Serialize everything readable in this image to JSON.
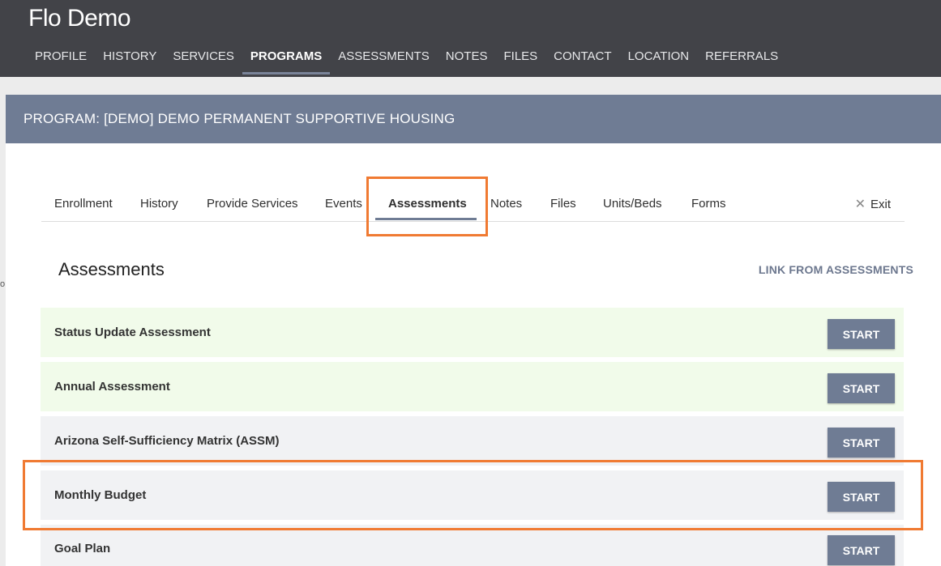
{
  "app": {
    "title": "Flo Demo"
  },
  "main_nav": [
    "PROFILE",
    "HISTORY",
    "SERVICES",
    "PROGRAMS",
    "ASSESSMENTS",
    "NOTES",
    "FILES",
    "CONTACT",
    "LOCATION",
    "REFERRALS"
  ],
  "program": {
    "title": "PROGRAM: [DEMO] DEMO PERMANENT SUPPORTIVE HOUSING"
  },
  "sub_tabs": [
    "Enrollment",
    "History",
    "Provide Services",
    "Events",
    "Assessments",
    "Notes",
    "Files",
    "Units/Beds",
    "Forms"
  ],
  "exit_label": "Exit",
  "section": {
    "title": "Assessments",
    "link": "LINK FROM ASSESSMENTS"
  },
  "assessments": [
    {
      "name": "Status Update Assessment",
      "button": "START"
    },
    {
      "name": "Annual Assessment",
      "button": "START"
    },
    {
      "name": "Arizona Self-Sufficiency Matrix (ASSM)",
      "button": "START"
    },
    {
      "name": "Monthly Budget",
      "button": "START"
    },
    {
      "name": "Goal Plan",
      "button": "START"
    }
  ],
  "colors": {
    "topbar": "#424348",
    "accent": "#6f7c94",
    "highlight": "#f07a32",
    "row_green": "#f1fbea",
    "row_grey": "#f1f2f4"
  }
}
